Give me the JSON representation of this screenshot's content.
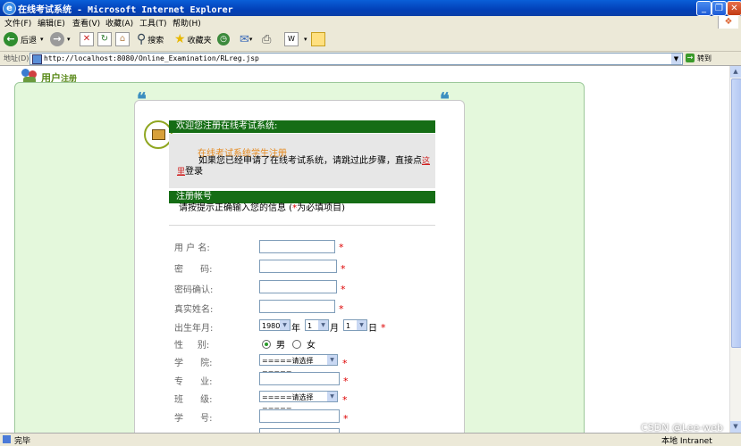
{
  "window": {
    "title": "在线考试系统 - Microsoft Internet Explorer"
  },
  "menubar": {
    "items": [
      "文件(F)",
      "编辑(E)",
      "查看(V)",
      "收藏(A)",
      "工具(T)",
      "帮助(H)"
    ]
  },
  "toolbar": {
    "back_label": "后退",
    "search_label": "搜索",
    "favorites_label": "收藏夹",
    "icons": [
      "back-icon",
      "forward-icon",
      "stop-icon",
      "refresh-icon",
      "home-icon",
      "search-icon",
      "favorites-icon",
      "history-icon",
      "mail-icon",
      "print-icon",
      "edit-icon",
      "folder-icon"
    ]
  },
  "addressbar": {
    "label": "地址(D)",
    "url": "http://localhost:8080/Online_Examination/RLreg.jsp",
    "go_label": "转到"
  },
  "page": {
    "header": {
      "title": "用户",
      "title_small": "注册"
    },
    "welcome": "欢迎您注册在线考试系统:",
    "link_student": "在线考试系统学生注册",
    "info_before": "如果您已经申请了在线考试系统，请跳过此步骤，直接点",
    "info_link": "这里",
    "info_after": "登录",
    "section_title": "注册帐号",
    "hint_before": "请按提示正确输入您的信息  (",
    "hint_star": "*",
    "hint_after": "为必填项目)",
    "fields": {
      "username": "用 户 名:",
      "password": "密      码:",
      "confirm": "密码确认:",
      "realname": "真实姓名:",
      "birth": "出生年月:",
      "gender": "性     别:",
      "college": "学      院:",
      "major": "专      业:",
      "class": "班      级:",
      "student_id": "学      号:"
    },
    "birth": {
      "year": "1980",
      "year_unit": "年",
      "month": "1",
      "month_unit": "月",
      "day": "1",
      "day_unit": "日"
    },
    "gender": {
      "male": "男",
      "female": "女",
      "selected": "男"
    },
    "select_placeholder": "=====请选择=====",
    "required_mark": "*"
  },
  "statusbar": {
    "status": "完毕",
    "zone": "本地 Intranet",
    "watermark": "CSDN @Lee-web"
  }
}
